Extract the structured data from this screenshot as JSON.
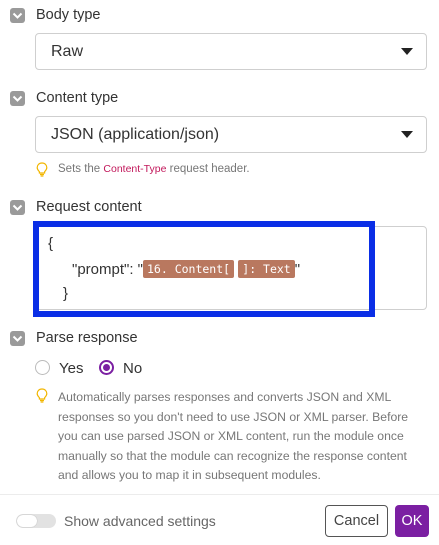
{
  "body_type": {
    "label": "Body type",
    "value": "Raw"
  },
  "content_type": {
    "label": "Content type",
    "value": "JSON (application/json)",
    "hint_prefix": "Sets the",
    "hint_code": "Content-Type",
    "hint_suffix": "request header."
  },
  "request_content": {
    "label": "Request content",
    "line1": "{",
    "key": "\"prompt\": \"",
    "pill1": "16. Content[",
    "pill2": "]: Text",
    "quote_end": "\"",
    "line3": "}"
  },
  "parse_response": {
    "label": "Parse response",
    "options": [
      "Yes",
      "No"
    ],
    "selected": "No",
    "description": "Automatically parses responses and converts JSON and XML responses so you don't need to use JSON or XML parser. Before you can use parsed JSON or XML content, run the module once manually so that the module can recognize the response content and allows you to map it in subsequent modules."
  },
  "footer": {
    "advanced_label": "Show advanced settings",
    "advanced_enabled": false,
    "cancel_label": "Cancel",
    "ok_label": "OK"
  },
  "colors": {
    "accent": "#7b1fa2",
    "highlight_border": "#0a2ee6",
    "pill": "#b9785f",
    "hint_code": "#c2185b"
  }
}
